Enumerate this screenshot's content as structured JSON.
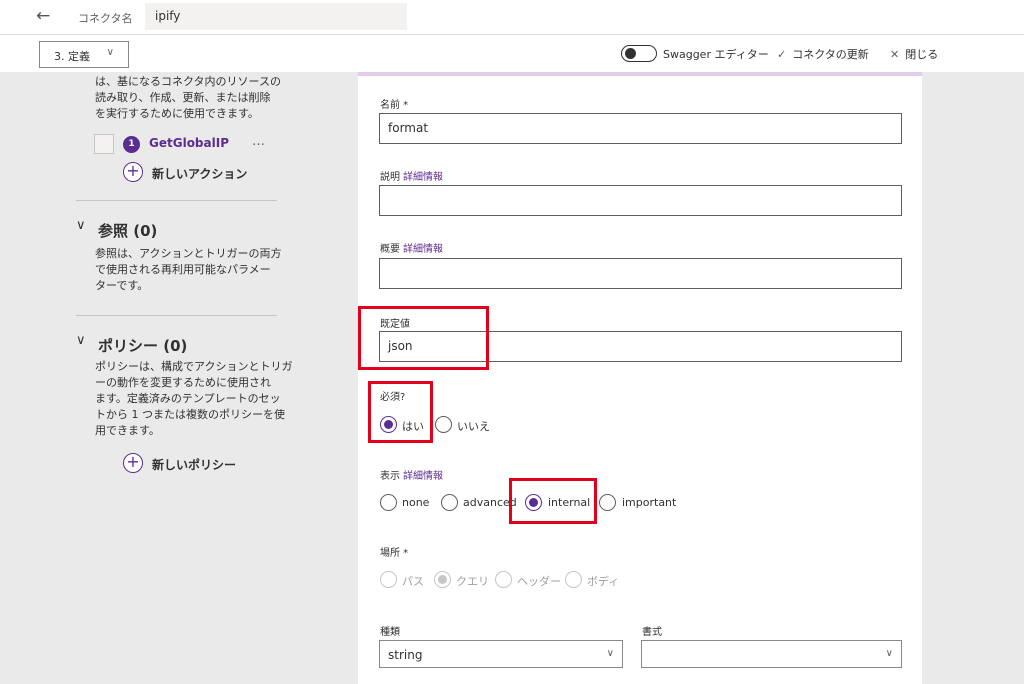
{
  "topbar": {
    "back_icon": "←",
    "connector_label": "コネクタ名",
    "connector_name": "ipify"
  },
  "cmdbar": {
    "step": "3. 定義",
    "swagger_label": "Swagger エディター",
    "update_label": "コネクタの更新",
    "close_label": "閉じる"
  },
  "left": {
    "actions_desc": [
      "は、基になるコネクタ内のリソースの",
      "読み取り、作成、更新、または削除",
      "を実行するために使用できます。"
    ],
    "action_number": "1",
    "action_name": "GetGlobalIP",
    "action_more": "…",
    "new_action": "新しいアクション",
    "ref_title": "参照 (0)",
    "ref_desc": [
      "参照は、アクションとトリガーの両方",
      "で使用される再利用可能なパラメー",
      "ターです。"
    ],
    "policy_title": "ポリシー (0)",
    "policy_desc": [
      "ポリシーは、構成でアクションとトリガ",
      "ーの動作を変更するために使用され",
      "ます。定義済みのテンプレートのセッ",
      "トから 1 つまたは複数のポリシーを使",
      "用できます。"
    ],
    "new_policy": "新しいポリシー"
  },
  "form": {
    "name_label": "名前 *",
    "name_value": "format",
    "desc_label": "説明",
    "desc_link": "詳細情報",
    "desc_value": "",
    "summary_label": "概要",
    "summary_link": "詳細情報",
    "summary_value": "",
    "default_label": "既定値",
    "default_value": "json",
    "required_label": "必須?",
    "required_yes": "はい",
    "required_no": "いいえ",
    "visibility_label": "表示",
    "visibility_link": "詳細情報",
    "visibility_options": [
      "none",
      "advanced",
      "internal",
      "important"
    ],
    "visibility_selected": "internal",
    "location_label": "場所 *",
    "location_options": [
      "パス",
      "クエリ",
      "ヘッダー",
      "ボディ"
    ],
    "location_selected": "クエリ",
    "type_label": "種類",
    "type_value": "string",
    "format_label": "書式",
    "format_value": ""
  },
  "colors": {
    "accent": "#5c2d91",
    "highlight": "#e3001b"
  }
}
